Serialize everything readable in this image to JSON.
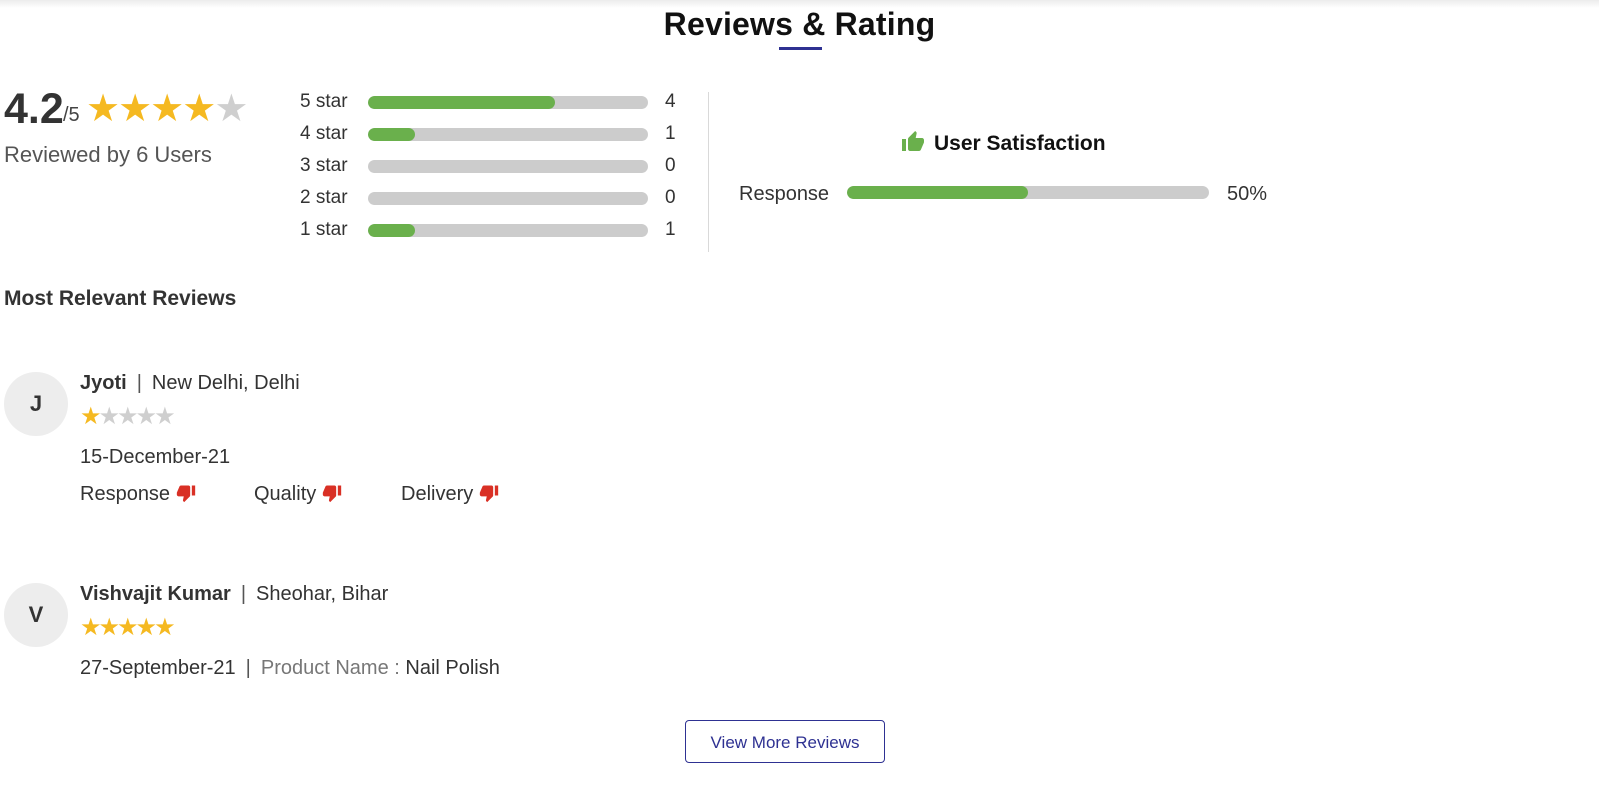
{
  "section_title": "Reviews & Rating",
  "colors": {
    "accent": "#2e3192",
    "bar_fill": "#6ab04c",
    "bar_track": "#cccccc",
    "star": "#f5b921",
    "star_empty": "#cfcfcf",
    "thumbs_down": "#d93025"
  },
  "overall": {
    "score": "4.2",
    "out_of": "/5",
    "stars_filled": 4,
    "stars_total": 5,
    "reviewed_by": "Reviewed by 6 Users"
  },
  "distribution": [
    {
      "label": "5 star",
      "count": "4",
      "fraction": 0.667
    },
    {
      "label": "4 star",
      "count": "1",
      "fraction": 0.167
    },
    {
      "label": "3 star",
      "count": "0",
      "fraction": 0
    },
    {
      "label": "2 star",
      "count": "0",
      "fraction": 0
    },
    {
      "label": "1 star",
      "count": "1",
      "fraction": 0.167
    }
  ],
  "satisfaction": {
    "title": "User Satisfaction",
    "icon": "thumbs-up-icon",
    "metrics": [
      {
        "label": "Response",
        "value": "50%",
        "fraction": 0.5
      }
    ]
  },
  "reviews_heading": "Most Relevant Reviews",
  "reviews": [
    {
      "initial": "J",
      "name": "Jyoti",
      "location": "New Delhi, Delhi",
      "stars": 1,
      "date": "15-December-21",
      "criteria": [
        {
          "label": "Response",
          "icon": "thumbs-down-icon"
        },
        {
          "label": "Quality",
          "icon": "thumbs-down-icon"
        },
        {
          "label": "Delivery",
          "icon": "thumbs-down-icon"
        }
      ]
    },
    {
      "initial": "V",
      "name": "Vishvajit Kumar",
      "location": "Sheohar, Bihar",
      "stars": 5,
      "date": "27-September-21",
      "product_label": "Product Name :",
      "product_name": "Nail Polish"
    }
  ],
  "view_more_label": "View More Reviews",
  "separator": "|"
}
